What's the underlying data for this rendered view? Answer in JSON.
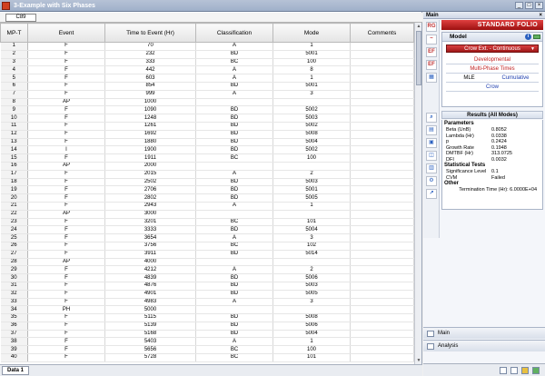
{
  "window": {
    "title": "3-Example with Six Phases",
    "buttons": [
      "_",
      "□",
      "×"
    ]
  },
  "sheet": {
    "cell_ref": "C89",
    "tab": "Data 1",
    "columns": [
      "MP-T",
      "Event",
      "Time to Event (Hr)",
      "Classification",
      "Mode",
      "Comments"
    ],
    "rows": [
      [
        "1",
        "F",
        "70",
        "A",
        "1",
        ""
      ],
      [
        "2",
        "F",
        "232",
        "BD",
        "5001",
        ""
      ],
      [
        "3",
        "F",
        "333",
        "BC",
        "100",
        ""
      ],
      [
        "4",
        "F",
        "442",
        "A",
        "8",
        ""
      ],
      [
        "5",
        "F",
        "603",
        "A",
        "1",
        ""
      ],
      [
        "6",
        "F",
        "854",
        "BD",
        "5001",
        ""
      ],
      [
        "7",
        "F",
        "999",
        "A",
        "3",
        ""
      ],
      [
        "8",
        "AP",
        "1000",
        "",
        "",
        ""
      ],
      [
        "9",
        "F",
        "1090",
        "BD",
        "5002",
        ""
      ],
      [
        "10",
        "F",
        "1248",
        "BD",
        "5003",
        ""
      ],
      [
        "11",
        "F",
        "1261",
        "BD",
        "5002",
        ""
      ],
      [
        "12",
        "F",
        "1692",
        "BD",
        "5008",
        ""
      ],
      [
        "13",
        "F",
        "1880",
        "BD",
        "5004",
        ""
      ],
      [
        "14",
        "I",
        "1900",
        "BD",
        "5002",
        ""
      ],
      [
        "15",
        "F",
        "1911",
        "BC",
        "100",
        ""
      ],
      [
        "16",
        "AP",
        "2000",
        "",
        "",
        ""
      ],
      [
        "17",
        "F",
        "2015",
        "A",
        "2",
        ""
      ],
      [
        "18",
        "F",
        "2502",
        "BD",
        "5003",
        ""
      ],
      [
        "19",
        "F",
        "2706",
        "BD",
        "5001",
        ""
      ],
      [
        "20",
        "F",
        "2802",
        "BD",
        "5005",
        ""
      ],
      [
        "21",
        "F",
        "2943",
        "A",
        "1",
        ""
      ],
      [
        "22",
        "AP",
        "3000",
        "",
        "",
        ""
      ],
      [
        "23",
        "F",
        "3201",
        "BC",
        "101",
        ""
      ],
      [
        "24",
        "F",
        "3333",
        "BD",
        "5004",
        ""
      ],
      [
        "25",
        "F",
        "3654",
        "A",
        "3",
        ""
      ],
      [
        "26",
        "F",
        "3756",
        "BC",
        "102",
        ""
      ],
      [
        "27",
        "F",
        "3911",
        "BD",
        "5014",
        ""
      ],
      [
        "28",
        "AP",
        "4000",
        "",
        "",
        ""
      ],
      [
        "29",
        "F",
        "4212",
        "A",
        "2",
        ""
      ],
      [
        "30",
        "F",
        "4839",
        "BD",
        "5006",
        ""
      ],
      [
        "31",
        "F",
        "4876",
        "BD",
        "5003",
        ""
      ],
      [
        "32",
        "F",
        "4901",
        "BD",
        "5005",
        ""
      ],
      [
        "33",
        "F",
        "4983",
        "A",
        "3",
        ""
      ],
      [
        "34",
        "PH",
        "5000",
        "",
        "",
        ""
      ],
      [
        "35",
        "F",
        "5115",
        "BD",
        "5008",
        ""
      ],
      [
        "36",
        "F",
        "5139",
        "BD",
        "5006",
        ""
      ],
      [
        "37",
        "F",
        "5168",
        "BD",
        "5004",
        ""
      ],
      [
        "38",
        "F",
        "5403",
        "A",
        "1",
        ""
      ],
      [
        "39",
        "F",
        "5656",
        "BC",
        "100",
        ""
      ],
      [
        "40",
        "F",
        "5728",
        "BC",
        "101",
        ""
      ]
    ]
  },
  "panel": {
    "header": "Main",
    "folio": "STANDARD FOLIO",
    "tools": [
      "RG",
      "~",
      "EF",
      "EF"
    ],
    "model": {
      "title": "Model",
      "selected": "Crow Ext. - Continuous",
      "opt_developmental": "Developmental",
      "opt_multiphase": "Multi-Phase Times",
      "opt_mle": "MLE",
      "opt_cumulative": "Cumulative",
      "opt_crow": "Crow"
    },
    "results": {
      "title": "Results (All Modes)",
      "parameters_label": "Parameters",
      "parameters": [
        {
          "k": "Beta (UnB)",
          "v": "0.8052"
        },
        {
          "k": "Lambda (Hr)",
          "v": "0.0338"
        },
        {
          "k": "p",
          "v": "0.2424"
        },
        {
          "k": "Growth Rate",
          "v": "0.1948"
        },
        {
          "k": "DMTBF (Hr)",
          "v": "313.0725"
        },
        {
          "k": "DFI",
          "v": "0.0032"
        }
      ],
      "stat_label": "Statistical Tests",
      "stats": [
        {
          "k": "Significance Level",
          "v": "0.1"
        },
        {
          "k": "CVM",
          "v": "Failed"
        }
      ],
      "other_label": "Other",
      "termination": "Termination Time (Hr): 6.0000E+04"
    },
    "bottom_main": "Main",
    "bottom_analysis": "Analysis"
  }
}
